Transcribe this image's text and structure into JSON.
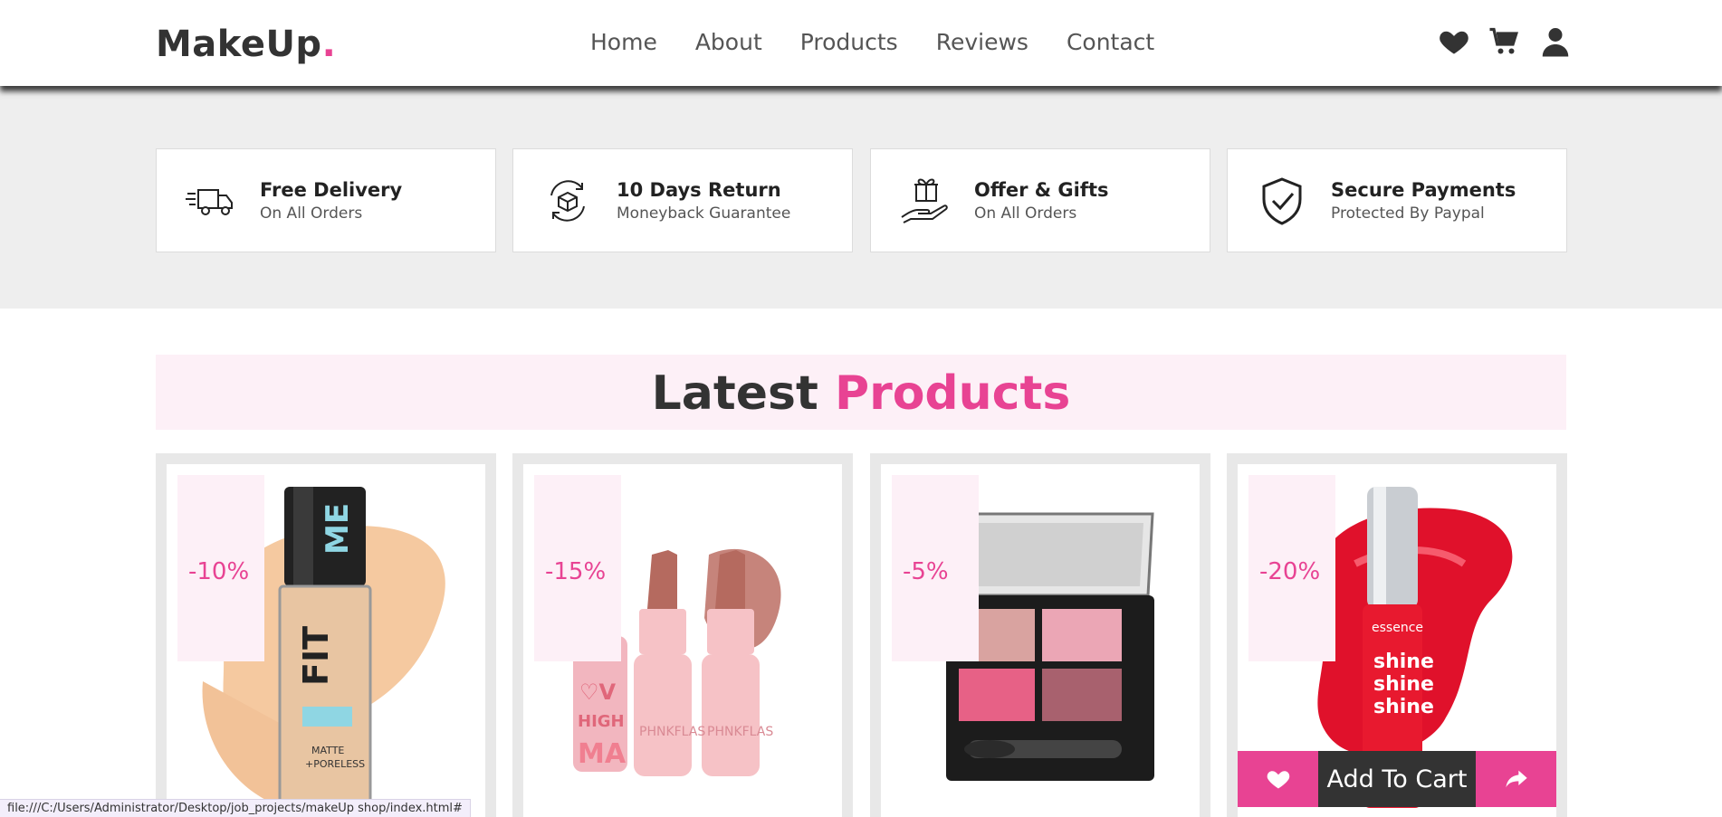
{
  "brand": {
    "name": "MakeUp",
    "dot": "."
  },
  "nav": [
    "Home",
    "About",
    "Products",
    "Reviews",
    "Contact"
  ],
  "header_icons": [
    "heart-icon",
    "cart-icon",
    "user-icon"
  ],
  "features": [
    {
      "title": "Free Delivery",
      "subtitle": "On All Orders",
      "icon": "truck-icon"
    },
    {
      "title": "10 Days Return",
      "subtitle": "Moneyback Guarantee",
      "icon": "return-box-icon"
    },
    {
      "title": "Offer & Gifts",
      "subtitle": "On All Orders",
      "icon": "gift-hand-icon"
    },
    {
      "title": "Secure Payments",
      "subtitle": "Protected By Paypal",
      "icon": "shield-check-icon"
    }
  ],
  "section": {
    "title_main": "Latest",
    "title_accent": "Products"
  },
  "products": [
    {
      "discount": "-10%",
      "image": "foundation-bottle-image"
    },
    {
      "discount": "-15%",
      "image": "lipstick-set-image"
    },
    {
      "discount": "-5%",
      "image": "eyeshadow-palette-image"
    },
    {
      "discount": "-20%",
      "image": "lip-gloss-image"
    }
  ],
  "card_actions": {
    "add_to_cart": "Add To Cart"
  },
  "status_url": "file:///C:/Users/Administrator/Desktop/job_projects/makeUp shop/index.html#",
  "colors": {
    "accent": "#e84393",
    "dark": "#333333",
    "band": "#eeeeee",
    "pink_light": "#fdf0f7"
  }
}
